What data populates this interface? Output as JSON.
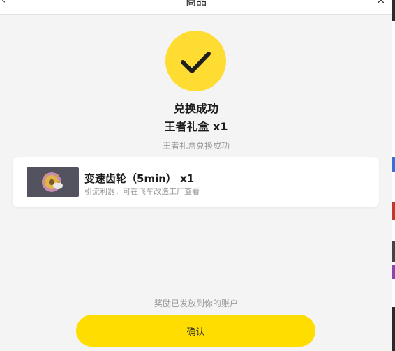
{
  "header": {
    "title": "商品",
    "back_icon": "chevron-left-icon",
    "close_icon": "close-icon",
    "back_glyph": "‹",
    "close_glyph": "×"
  },
  "result": {
    "icon": "checkmark-icon",
    "icon_color": "#fedc32",
    "headline": "兑换成功",
    "item_line": "王者礼盒 x1",
    "note": "王者礼盒兑换成功"
  },
  "reward_item": {
    "name": "变速齿轮（5min） x1",
    "description": "引流利器，可在飞车改造工厂查看",
    "thumbnail_icon": "gear-item-icon"
  },
  "footer": {
    "note": "奖励已发放到你的账户",
    "confirm_label": "确认",
    "accent": "#ffdd00"
  }
}
